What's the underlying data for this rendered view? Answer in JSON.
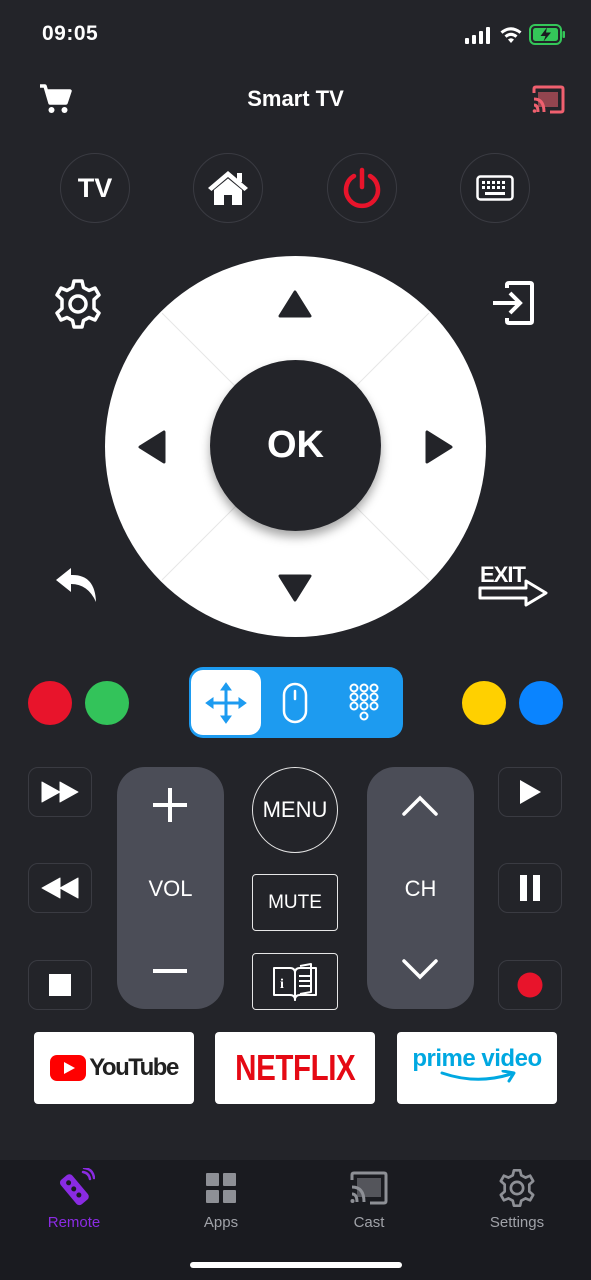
{
  "status": {
    "time": "09:05"
  },
  "header": {
    "title": "Smart TV"
  },
  "top_buttons": {
    "tv": "TV"
  },
  "dpad": {
    "ok": "OK"
  },
  "side_buttons": {
    "exit": "EXIT"
  },
  "controls": {
    "vol": "VOL",
    "ch": "CH",
    "menu": "MENU",
    "mute": "MUTE"
  },
  "apps": {
    "youtube": "YouTube",
    "netflix": "NETFLIX",
    "prime_top": "prime video"
  },
  "tabs": [
    {
      "label": "Remote",
      "active": true
    },
    {
      "label": "Apps"
    },
    {
      "label": "Cast"
    },
    {
      "label": "Settings"
    }
  ],
  "colors": {
    "red": "#e8142b",
    "green": "#33c35a",
    "yellow": "#ffd000",
    "blue": "#0a84ff",
    "accent": "#8a2be2",
    "mode_blue": "#1d9bf0"
  }
}
